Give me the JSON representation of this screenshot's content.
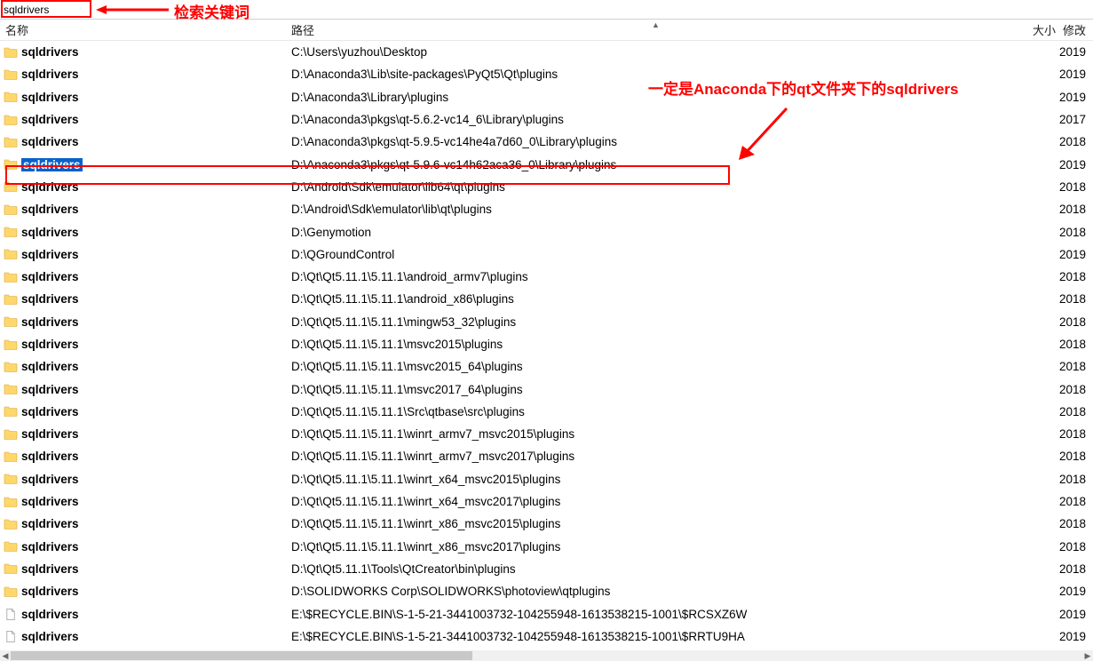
{
  "search": {
    "value": "sqldrivers"
  },
  "annotations": {
    "label1": "检索关键词",
    "label2": "一定是Anaconda下的qt文件夹下的sqldrivers"
  },
  "columns": {
    "name": "名称",
    "path": "路径",
    "size": "大小",
    "modified": "修改"
  },
  "selected_index": 5,
  "rows": [
    {
      "type": "folder",
      "name": "sqldrivers",
      "path": "C:\\Users\\yuzhou\\Desktop",
      "mod": "2019"
    },
    {
      "type": "folder",
      "name": "sqldrivers",
      "path": "D:\\Anaconda3\\Lib\\site-packages\\PyQt5\\Qt\\plugins",
      "mod": "2019"
    },
    {
      "type": "folder",
      "name": "sqldrivers",
      "path": "D:\\Anaconda3\\Library\\plugins",
      "mod": "2019"
    },
    {
      "type": "folder",
      "name": "sqldrivers",
      "path": "D:\\Anaconda3\\pkgs\\qt-5.6.2-vc14_6\\Library\\plugins",
      "mod": "2017"
    },
    {
      "type": "folder",
      "name": "sqldrivers",
      "path": "D:\\Anaconda3\\pkgs\\qt-5.9.5-vc14he4a7d60_0\\Library\\plugins",
      "mod": "2018"
    },
    {
      "type": "folder",
      "name": "sqldrivers",
      "path": "D:\\Anaconda3\\pkgs\\qt-5.9.6-vc14h62aca36_0\\Library\\plugins",
      "mod": "2019"
    },
    {
      "type": "folder",
      "name": "sqldrivers",
      "path": "D:\\Android\\Sdk\\emulator\\lib64\\qt\\plugins",
      "mod": "2018"
    },
    {
      "type": "folder",
      "name": "sqldrivers",
      "path": "D:\\Android\\Sdk\\emulator\\lib\\qt\\plugins",
      "mod": "2018"
    },
    {
      "type": "folder",
      "name": "sqldrivers",
      "path": "D:\\Genymotion",
      "mod": "2018"
    },
    {
      "type": "folder",
      "name": "sqldrivers",
      "path": "D:\\QGroundControl",
      "mod": "2019"
    },
    {
      "type": "folder",
      "name": "sqldrivers",
      "path": "D:\\Qt\\Qt5.11.1\\5.11.1\\android_armv7\\plugins",
      "mod": "2018"
    },
    {
      "type": "folder",
      "name": "sqldrivers",
      "path": "D:\\Qt\\Qt5.11.1\\5.11.1\\android_x86\\plugins",
      "mod": "2018"
    },
    {
      "type": "folder",
      "name": "sqldrivers",
      "path": "D:\\Qt\\Qt5.11.1\\5.11.1\\mingw53_32\\plugins",
      "mod": "2018"
    },
    {
      "type": "folder",
      "name": "sqldrivers",
      "path": "D:\\Qt\\Qt5.11.1\\5.11.1\\msvc2015\\plugins",
      "mod": "2018"
    },
    {
      "type": "folder",
      "name": "sqldrivers",
      "path": "D:\\Qt\\Qt5.11.1\\5.11.1\\msvc2015_64\\plugins",
      "mod": "2018"
    },
    {
      "type": "folder",
      "name": "sqldrivers",
      "path": "D:\\Qt\\Qt5.11.1\\5.11.1\\msvc2017_64\\plugins",
      "mod": "2018"
    },
    {
      "type": "folder",
      "name": "sqldrivers",
      "path": "D:\\Qt\\Qt5.11.1\\5.11.1\\Src\\qtbase\\src\\plugins",
      "mod": "2018"
    },
    {
      "type": "folder",
      "name": "sqldrivers",
      "path": "D:\\Qt\\Qt5.11.1\\5.11.1\\winrt_armv7_msvc2015\\plugins",
      "mod": "2018"
    },
    {
      "type": "folder",
      "name": "sqldrivers",
      "path": "D:\\Qt\\Qt5.11.1\\5.11.1\\winrt_armv7_msvc2017\\plugins",
      "mod": "2018"
    },
    {
      "type": "folder",
      "name": "sqldrivers",
      "path": "D:\\Qt\\Qt5.11.1\\5.11.1\\winrt_x64_msvc2015\\plugins",
      "mod": "2018"
    },
    {
      "type": "folder",
      "name": "sqldrivers",
      "path": "D:\\Qt\\Qt5.11.1\\5.11.1\\winrt_x64_msvc2017\\plugins",
      "mod": "2018"
    },
    {
      "type": "folder",
      "name": "sqldrivers",
      "path": "D:\\Qt\\Qt5.11.1\\5.11.1\\winrt_x86_msvc2015\\plugins",
      "mod": "2018"
    },
    {
      "type": "folder",
      "name": "sqldrivers",
      "path": "D:\\Qt\\Qt5.11.1\\5.11.1\\winrt_x86_msvc2017\\plugins",
      "mod": "2018"
    },
    {
      "type": "folder",
      "name": "sqldrivers",
      "path": "D:\\Qt\\Qt5.11.1\\Tools\\QtCreator\\bin\\plugins",
      "mod": "2018"
    },
    {
      "type": "folder",
      "name": "sqldrivers",
      "path": "D:\\SOLIDWORKS Corp\\SOLIDWORKS\\photoview\\qtplugins",
      "mod": "2019"
    },
    {
      "type": "file",
      "name": "sqldrivers",
      "path": "E:\\$RECYCLE.BIN\\S-1-5-21-3441003732-104255948-1613538215-1001\\$RCSXZ6W",
      "mod": "2019"
    },
    {
      "type": "file",
      "name": "sqldrivers",
      "path": "E:\\$RECYCLE.BIN\\S-1-5-21-3441003732-104255948-1613538215-1001\\$RRTU9HA",
      "mod": "2019"
    }
  ]
}
